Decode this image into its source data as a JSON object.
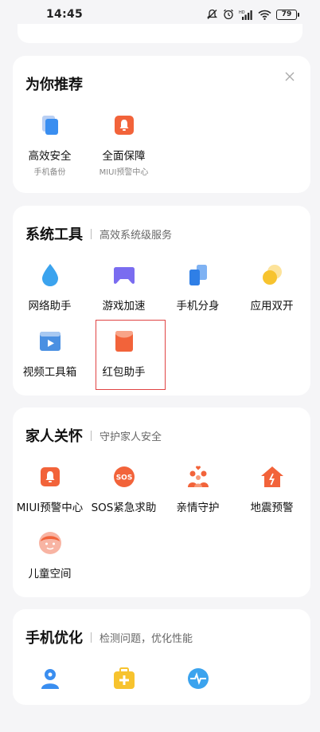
{
  "status_bar": {
    "time": "14:45",
    "battery": "79"
  },
  "recommend": {
    "title": "为你推荐",
    "items": [
      {
        "label": "高效安全",
        "sub": "手机备份"
      },
      {
        "label": "全面保障",
        "sub": "MIUI预警中心"
      }
    ]
  },
  "system_tools": {
    "title": "系统工具",
    "subtitle": "高效系统级服务",
    "items": [
      {
        "label": "网络助手"
      },
      {
        "label": "游戏加速"
      },
      {
        "label": "手机分身"
      },
      {
        "label": "应用双开"
      },
      {
        "label": "视频工具箱"
      },
      {
        "label": "红包助手"
      }
    ]
  },
  "family_care": {
    "title": "家人关怀",
    "subtitle": "守护家人安全",
    "items": [
      {
        "label": "MIUI预警中心"
      },
      {
        "label": "SOS紧急求助",
        "icon_text": "SOS"
      },
      {
        "label": "亲情守护"
      },
      {
        "label": "地震预警"
      },
      {
        "label": "儿童空间"
      }
    ]
  },
  "phone_optimize": {
    "title": "手机优化",
    "subtitle": "检测问题，优化性能"
  },
  "colors": {
    "accent_orange": "#f2633a",
    "blue": "#3a8ef0",
    "purple": "#7a6cf0",
    "yellow": "#f7c32e",
    "highlight_red": "#e04444"
  }
}
